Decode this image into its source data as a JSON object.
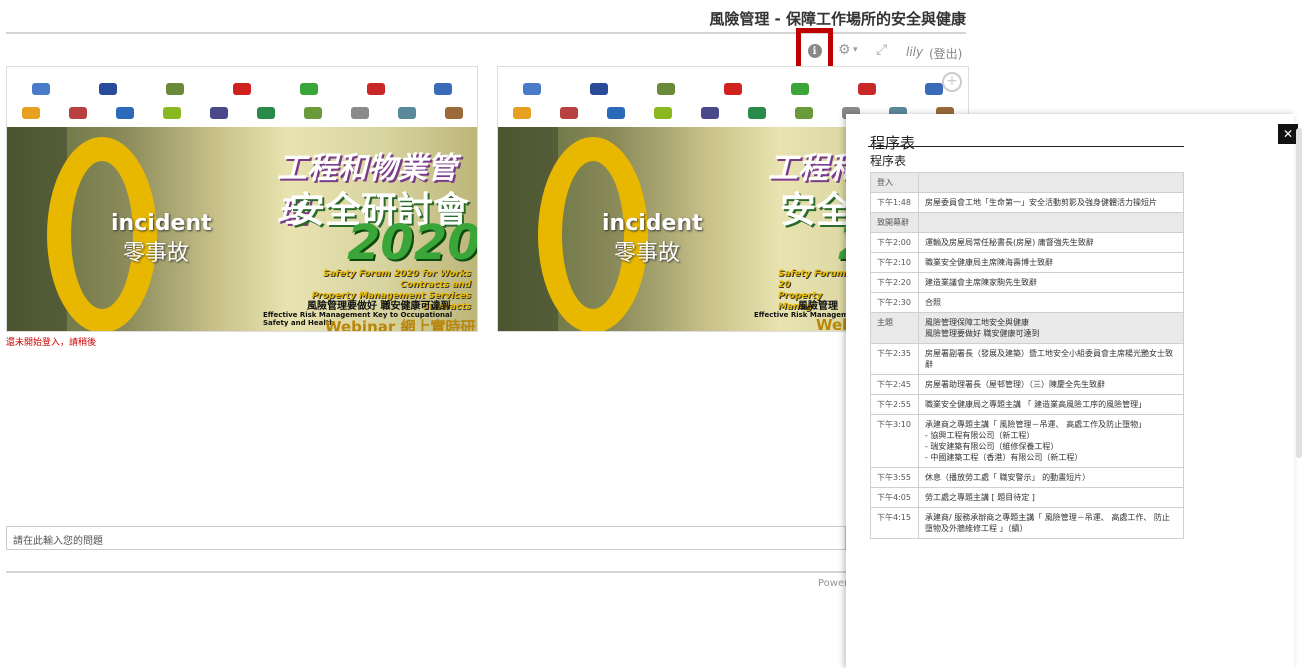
{
  "page": {
    "title": "風險管理 - 保障工作場所的安全與健康",
    "toolbar": {
      "info_icon": "info-icon",
      "gear_icon": "gear-icon",
      "expand_icon": "expand-icon",
      "user": "lily",
      "logout": "(登出)"
    },
    "login_hint": "還未開始登入，請稍後",
    "question_placeholder": "請在此輸入您的問題",
    "powered": "Power"
  },
  "banner": {
    "incident": "incident",
    "zero_cn": "零事故",
    "title_line1": "工程和物業管理",
    "title_line2": "安全研討會",
    "year": "2020",
    "forum_en_1": "Safety Forum 2020 for Works Contracts and",
    "forum_en_2": "Property Management Services Contracts",
    "risk_cn": "風險管理要做好  職安健康可達到",
    "risk_en": "Effective Risk Management   Key to Occupational Safety and Health",
    "webinar": "Webinar 網上實時研討會"
  },
  "banner2": {
    "incident": "incident",
    "zero_cn": "零事故",
    "title_line1": "工程和物",
    "title_line2": "安全",
    "year": "2",
    "forum_en_1": "Safety Forum 20",
    "forum_en_2": "Property Manag",
    "risk_cn": "風險管理",
    "risk_en": "Effective Risk Management",
    "webinar": "Webi"
  },
  "program": {
    "title": "程序表",
    "subtitle": "程序表",
    "rows": [
      {
        "time": "登入",
        "text": "",
        "hdr": true
      },
      {
        "time": "下午1:48",
        "text": "房屋委員會工地「生命第一」安全活動剪影及強身健體活力操短片",
        "hdr": false
      },
      {
        "time": "致開幕辭",
        "text": "",
        "hdr": true
      },
      {
        "time": "下午2:00",
        "text": "運輸及房屋局常任秘書長(房屋) 庸督強先生致辭",
        "hdr": false
      },
      {
        "time": "下午2:10",
        "text": "職業安全健康局主席陳海壽博士致辭",
        "hdr": false
      },
      {
        "time": "下午2:20",
        "text": "建造業議會主席陳家駒先生致辭",
        "hdr": false
      },
      {
        "time": "下午2:30",
        "text": "合照",
        "hdr": false
      },
      {
        "time": "主題",
        "text": "風險管理保障工地安全與健康\n風險管理要做好 職安健康可達到",
        "hdr": true
      },
      {
        "time": "下午2:35",
        "text": "房屋署副署長（發展及建築）暨工地安全小組委員會主席楊光艷女士致辭",
        "hdr": false
      },
      {
        "time": "下午2:45",
        "text": "房屋署助理署長（屋邨管理）（三）陳慶全先生致辭",
        "hdr": false
      },
      {
        "time": "下午2:55",
        "text": "職業安全健康局之專題主講 「 建造業高風險工序的風險管理」",
        "hdr": false
      },
      {
        "time": "下午3:10",
        "text": "承建商之專題主講「 風險管理－吊運、 高處工作及防止墮物」\n- 協興工程有限公司（新工程）\n- 瑞安建築有限公司（維修保養工程）\n- 中國建築工程（香港）有限公司（新工程）",
        "hdr": false
      },
      {
        "time": "下午3:55",
        "text": "休息（播放勞工處「 職安警示」 的動畫短片）",
        "hdr": false
      },
      {
        "time": "下午4:05",
        "text": "勞工處之專題主講 [ 題目待定 ]",
        "hdr": false
      },
      {
        "time": "下午4:15",
        "text": "承建商/ 服務承辦商之專題主講「 風險管理－吊運、 高處工作、 防止墮物及外牆維修工程 」（續）",
        "hdr": false
      }
    ]
  },
  "colors": {
    "highlight": "#c00000",
    "accent_gold": "#e8b800",
    "accent_green": "#3aa63a"
  }
}
